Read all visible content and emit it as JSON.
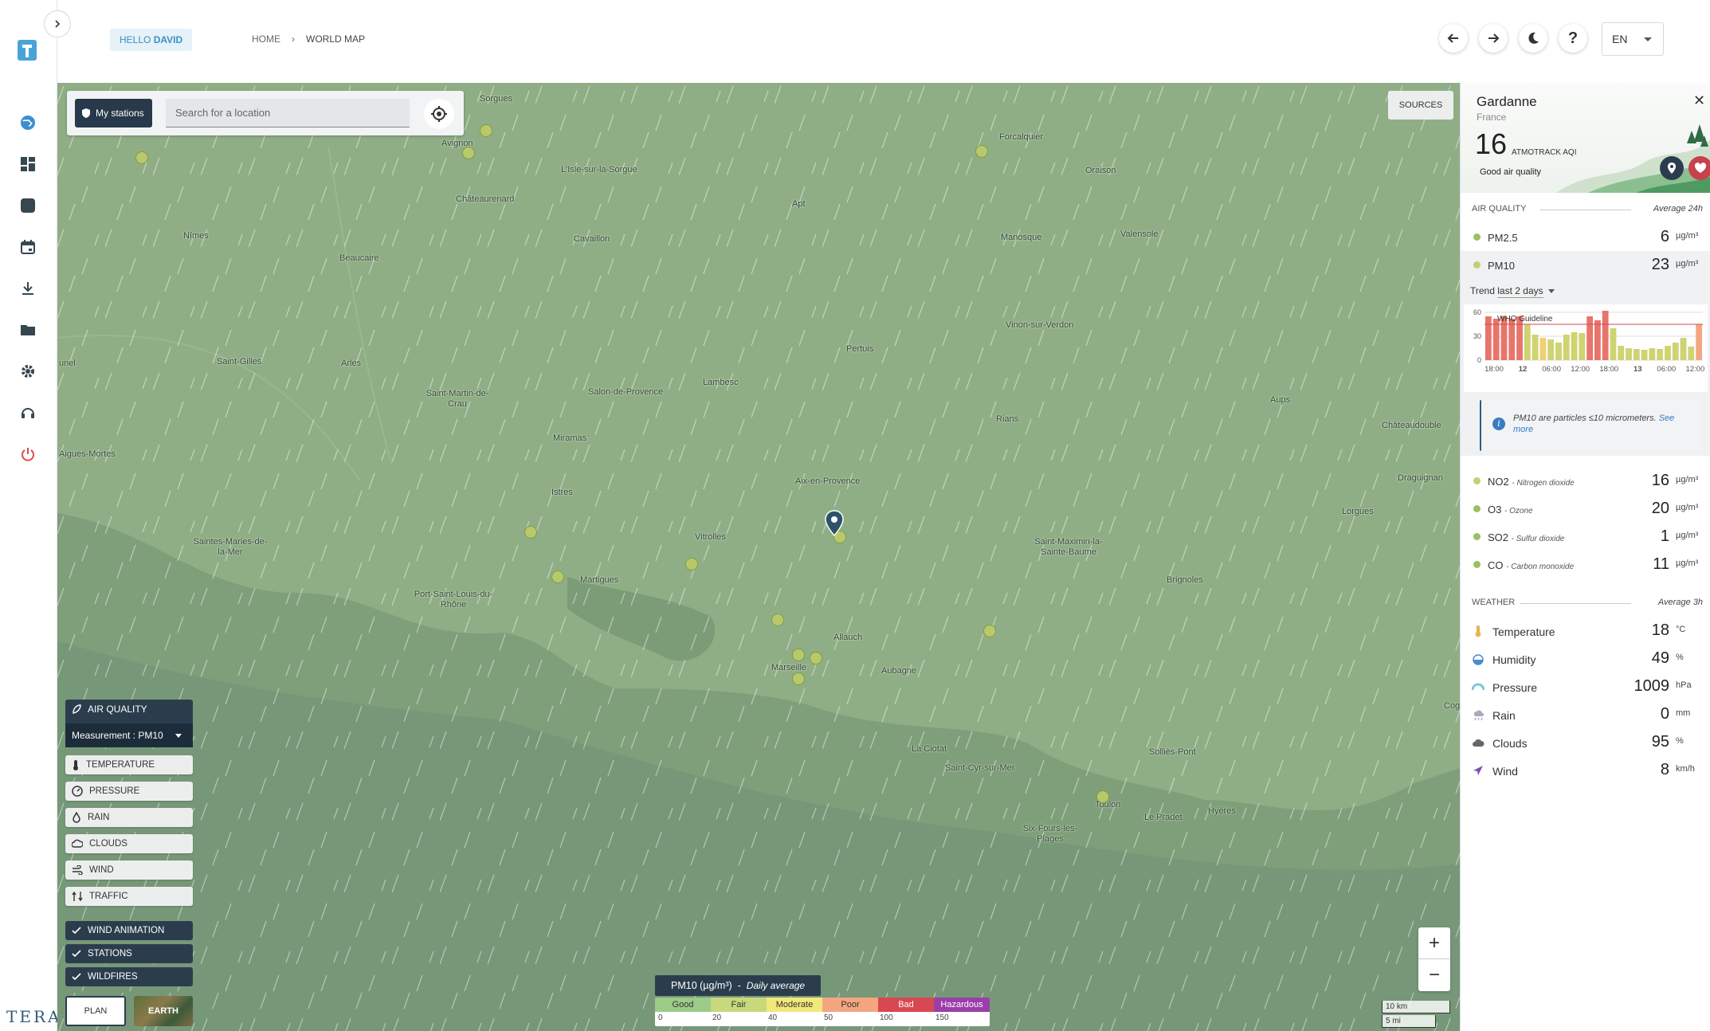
{
  "nav": {
    "greeting_prefix": "HELLO",
    "greeting_name": "DAVID",
    "breadcrumb": [
      "HOME",
      "WORLD MAP"
    ],
    "language": "EN",
    "brand": "TERA"
  },
  "search": {
    "my_stations_label": "My stations",
    "placeholder": "Search for a location"
  },
  "sources_label": "SOURCES",
  "layers": {
    "air_quality_label": "AIR QUALITY",
    "measurement_label": "Measurement : PM10",
    "items": [
      "TEMPERATURE",
      "PRESSURE",
      "RAIN",
      "CLOUDS",
      "WIND",
      "TRAFFIC"
    ],
    "toggles": [
      "WIND ANIMATION",
      "STATIONS",
      "WILDFIRES"
    ],
    "views": [
      "PLAN",
      "EARTH"
    ]
  },
  "legend": {
    "title": "PM10 (µg/m³)",
    "subtitle": "Daily average",
    "bands": [
      {
        "label": "Good",
        "color": "#9ccb8a"
      },
      {
        "label": "Fair",
        "color": "#c7d97c"
      },
      {
        "label": "Moderate",
        "color": "#f2e77b"
      },
      {
        "label": "Poor",
        "color": "#f3a67f"
      },
      {
        "label": "Bad",
        "color": "#d84852"
      },
      {
        "label": "Hazardous",
        "color": "#9b3ea8"
      }
    ],
    "ticks": [
      "0",
      "20",
      "40",
      "50",
      "100",
      "150"
    ]
  },
  "scale": {
    "km": "10 km",
    "mi": "5 mi"
  },
  "map": {
    "cities": [
      "Sorgues",
      "Avignon",
      "L'Isle-sur-la-Sorgue",
      "Châteaurenard",
      "Cavaillon",
      "Nîmes",
      "Beaucaire",
      "Apt",
      "Forcalquier",
      "Oraison",
      "Manosque",
      "Valensole",
      "Vinon-sur-Verdon",
      "Pertuis",
      "Saint-Gilles",
      "Arles",
      "unel",
      "Saint-Martin-de-Crau",
      "Salon-de-Provence",
      "Lambesc",
      "Miramas",
      "Rians",
      "Aups",
      "Châteaudouble",
      "Aigues-Mortes",
      "Istres",
      "Aix-en-Provence",
      "Draguignan",
      "Lorgues",
      "Vitrolles",
      "Saint-Maximin-la-Sainte-Baume",
      "Saintes-Maries-de-la-Mer",
      "Martigues",
      "Port-Saint-Louis-du-Rhône",
      "Brignoles",
      "Allauch",
      "Marseille",
      "Aubagne",
      "La Ciotat",
      "Saint-Cyr-sur-Mer",
      "Solliès-Pont",
      "Toulon",
      "Le Pradet",
      "Hyères",
      "Six-Fours-les-Plages",
      "Cog"
    ]
  },
  "panel": {
    "name": "Gardanne",
    "country": "France",
    "aqi_value": "16",
    "aqi_label": "ATMOTRACK AQI",
    "quality": "Good air quality",
    "air_quality_header": "AIR QUALITY",
    "air_quality_avg": "Average 24h",
    "pollutants_main": [
      {
        "name": "PM2.5",
        "value": "6",
        "unit": "µg/m³",
        "color": "#9bbf63"
      },
      {
        "name": "PM10",
        "value": "23",
        "unit": "µg/m³",
        "color": "#c4cf72"
      }
    ],
    "trend_label": "Trend",
    "trend_period": "last 2 days",
    "info_text": "PM10 are particles ≤10 micrometers.",
    "info_link": "See more",
    "pollutants_other": [
      {
        "name": "NO2",
        "desc": "Nitrogen dioxide",
        "value": "16",
        "unit": "µg/m³",
        "color": "#c4cf72"
      },
      {
        "name": "O3",
        "desc": "Ozone",
        "value": "20",
        "unit": "µg/m³",
        "color": "#9bbf63"
      },
      {
        "name": "SO2",
        "desc": "Sulfur dioxide",
        "value": "1",
        "unit": "µg/m³",
        "color": "#9bbf63"
      },
      {
        "name": "CO",
        "desc": "Carbon monoxide",
        "value": "11",
        "unit": "µg/m³",
        "color": "#9bbf63"
      }
    ],
    "weather_header": "WEATHER",
    "weather_avg": "Average 3h",
    "weather": [
      {
        "name": "Temperature",
        "value": "18",
        "unit": "°C",
        "icon": "thermometer-icon"
      },
      {
        "name": "Humidity",
        "value": "49",
        "unit": "%",
        "icon": "droplet-icon"
      },
      {
        "name": "Pressure",
        "value": "1009",
        "unit": "hPa",
        "icon": "gauge-icon"
      },
      {
        "name": "Rain",
        "value": "0",
        "unit": "mm",
        "icon": "rain-icon"
      },
      {
        "name": "Clouds",
        "value": "95",
        "unit": "%",
        "icon": "cloud-icon"
      },
      {
        "name": "Wind",
        "value": "8",
        "unit": "km/h",
        "icon": "wind-arrow-icon"
      }
    ]
  },
  "chart_data": {
    "type": "bar",
    "title": "",
    "ylim": [
      0,
      60
    ],
    "yticks": [
      "60",
      "30",
      "0"
    ],
    "xticks": [
      "18:00",
      "12",
      "06:00",
      "12:00",
      "18:00",
      "13",
      "06:00",
      "12:00"
    ],
    "guideline_label": "WHO Guideline",
    "guideline_value": 45,
    "values": [
      55,
      52,
      55,
      52,
      55,
      45,
      32,
      28,
      26,
      22,
      32,
      35,
      34,
      55,
      50,
      62,
      40,
      18,
      15,
      14,
      13,
      15,
      14,
      18,
      22,
      28,
      17,
      45
    ],
    "bar_colors": [
      "#e8756c",
      "#e8756c",
      "#e8756c",
      "#e8756c",
      "#e8756c",
      "#cfd372",
      "#cfd372",
      "#f2cf72",
      "#cfd372",
      "#cfd372",
      "#cfd372",
      "#cfd372",
      "#cfd372",
      "#e8756c",
      "#e8756c",
      "#e8756c",
      "#cfd372",
      "#cfd372",
      "#cfd372",
      "#cfd372",
      "#cfd372",
      "#cfd372",
      "#cfd372",
      "#cfd372",
      "#cfd372",
      "#cfd372",
      "#cfd372",
      "#f3a67f"
    ]
  }
}
